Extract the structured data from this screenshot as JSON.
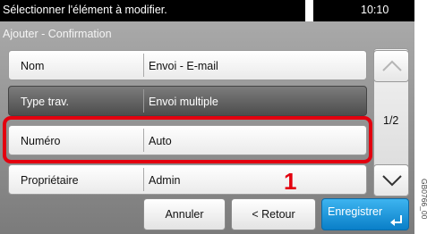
{
  "status": {
    "message": "Sélectionner l'élément à modifier.",
    "time": "10:10"
  },
  "header": {
    "title": "Ajouter - Confirmation"
  },
  "rows": [
    {
      "label": "Nom",
      "value": "Envoi - E-mail"
    },
    {
      "label": "Type trav.",
      "value": "Envoi multiple"
    },
    {
      "label": "Numéro",
      "value": "Auto"
    },
    {
      "label": "Propriétaire",
      "value": "Admin"
    }
  ],
  "pager": {
    "indicator": "1/2"
  },
  "buttons": {
    "cancel": "Annuler",
    "back": "< Retour",
    "save": "Enregistrer"
  },
  "callout": "1",
  "image_code": "GB0766_00",
  "colors": {
    "highlight": "#e3000f",
    "primary": "#0a7fc8"
  },
  "icons": {
    "up": "chevron-up-icon",
    "down": "chevron-down-icon",
    "enter": "enter-arrow-icon"
  }
}
